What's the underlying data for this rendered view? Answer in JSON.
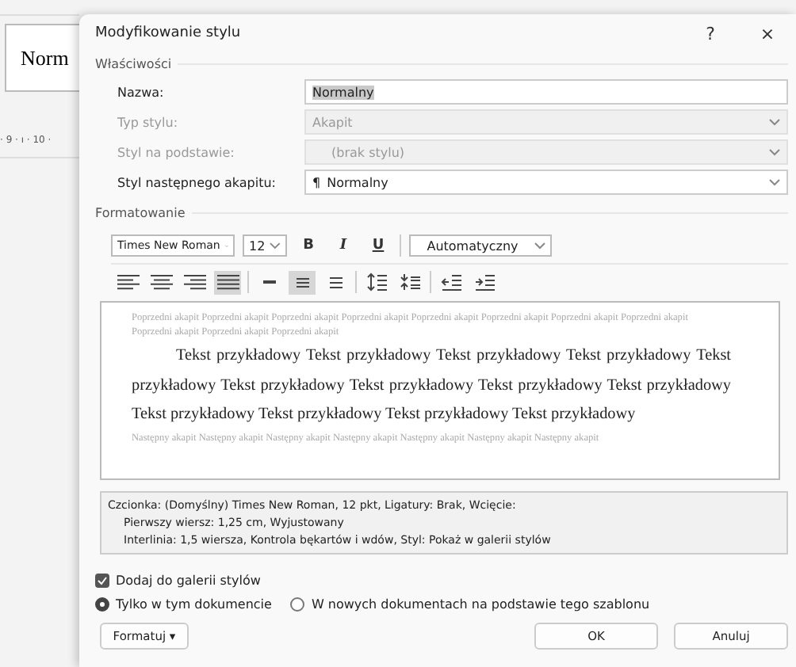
{
  "background": {
    "style_box": "Norm",
    "ruler": "· 9 · ı · 10 ·"
  },
  "window": {
    "title": "Modyfikowanie stylu",
    "help": "?",
    "close": "×"
  },
  "properties": {
    "heading": "Właściwości",
    "rows": [
      {
        "label": "Nazwa:",
        "value": "Normalny",
        "disabled": false,
        "kind": "text"
      },
      {
        "label": "Typ stylu:",
        "value": "Akapit",
        "disabled": true,
        "kind": "combo"
      },
      {
        "label": "Styl na podstawie:",
        "value": "(brak stylu)",
        "disabled": true,
        "kind": "combo"
      },
      {
        "label": "Styl następnego akapitu:",
        "marker": "¶",
        "value": "Normalny",
        "disabled": false,
        "kind": "combo"
      }
    ]
  },
  "formatting": {
    "heading": "Formatowanie",
    "font": "Times New Roman",
    "size": "12",
    "styles": [
      {
        "label": "B",
        "kind": "bold",
        "selected": false
      },
      {
        "label": "I",
        "kind": "italic",
        "selected": false
      },
      {
        "label": "U",
        "kind": "underline",
        "selected": false
      }
    ],
    "font_color": "Automatyczny",
    "paragraph_buttons": [
      {
        "kind": "align-left",
        "selected": false
      },
      {
        "kind": "align-center",
        "selected": false
      },
      {
        "kind": "align-right",
        "selected": false
      },
      {
        "kind": "justify",
        "selected": true
      },
      {
        "kind": "single-spacing",
        "selected": false
      },
      {
        "kind": "one-half-spacing",
        "selected": true
      },
      {
        "kind": "double-spacing",
        "selected": false
      },
      {
        "kind": "line-spacing",
        "selected": false
      },
      {
        "kind": "paragraph-spacing",
        "selected": false
      },
      {
        "kind": "decrease-indent",
        "selected": false
      },
      {
        "kind": "increase-indent",
        "selected": false
      }
    ]
  },
  "preview": {
    "previous": "Poprzedni akapit Poprzedni akapit Poprzedni akapit Poprzedni akapit Poprzedni akapit Poprzedni akapit Poprzedni akapit Poprzedni akapit Poprzedni akapit Poprzedni akapit Poprzedni akapit",
    "sample": "Tekst przykładowy Tekst przykładowy Tekst przykładowy Tekst przykładowy Tekst przykładowy Tekst przykładowy Tekst przykładowy Tekst przykładowy Tekst przykładowy Tekst przykładowy Tekst przykładowy Tekst przykładowy Tekst przykładowy",
    "next": "Następny akapit Następny akapit Następny akapit Następny akapit Następny akapit Następny akapit Następny akapit"
  },
  "description": [
    "Czcionka: (Domyślny) Times New Roman, 12 pkt, Ligatury: Brak, Wcięcie:",
    "Pierwszy wiersz:  1,25 cm, Wyjustowany",
    "Interlinia:  1,5 wiersza, Kontrola bękartów i wdów, Styl: Pokaż w galerii stylów"
  ],
  "add_to_gallery": {
    "label": "Dodaj do galerii stylów",
    "checked": true
  },
  "scope": [
    {
      "label": "Tylko w tym dokumencie",
      "selected": true
    },
    {
      "label": "W nowych dokumentach na podstawie tego szablonu",
      "selected": false
    }
  ],
  "buttons": [
    {
      "label": "Formatuj ▾",
      "kind": "menu"
    },
    {
      "label": "OK",
      "kind": "default"
    },
    {
      "label": "Anuluj",
      "kind": "cancel"
    }
  ]
}
